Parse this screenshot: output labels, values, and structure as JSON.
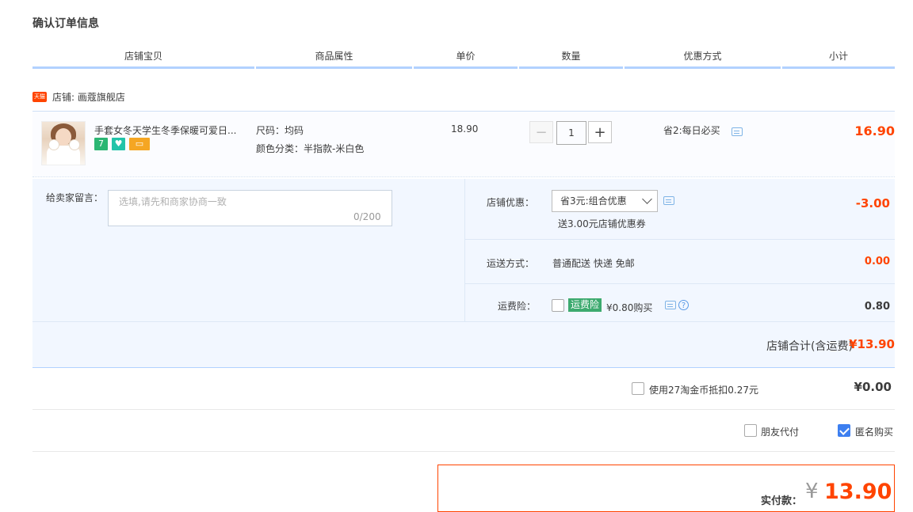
{
  "title": "确认订单信息",
  "columns": [
    "店铺宝贝",
    "商品属性",
    "单价",
    "数量",
    "优惠方式",
    "小计"
  ],
  "shop": {
    "logo_text": "天猫",
    "label": "店铺:",
    "name": "画蔻旗舰店"
  },
  "item": {
    "name": "手套女冬天学生冬季保暖可爱日...",
    "badges": [
      "7",
      "♥",
      "▭"
    ],
    "attr_size": "尺码：均码",
    "attr_color": "颜色分类：半指款-米白色",
    "unit_price": "18.90",
    "quantity": "1",
    "minus": "−",
    "plus": "+",
    "promo": "省2:每日必买",
    "subtotal": "16.90"
  },
  "message": {
    "label": "给卖家留言：",
    "placeholder": "选填,请先和商家协商一致",
    "count": "0/200"
  },
  "shop_discount": {
    "label": "店铺优惠：",
    "selected": "省3元:组合优惠",
    "note": "送3.00元店铺优惠券",
    "amount": "-3.00"
  },
  "shipping": {
    "label": "运送方式：",
    "value": "普通配送 快递 免邮",
    "amount": "0.00"
  },
  "insurance": {
    "label": "运费险：",
    "badge": "运费险",
    "text": "¥0.80购买",
    "help": "?",
    "amount": "0.80"
  },
  "shop_total": {
    "label": "店铺合计(含运费)",
    "amount": "¥13.90"
  },
  "taobao_coins": {
    "label": "使用27淘金币抵扣0.27元",
    "amount": "¥0.00"
  },
  "friend_pay": {
    "label": "朋友代付"
  },
  "anonymous": {
    "label": "匿名购买"
  },
  "pay": {
    "label": "实付款：",
    "currency": "¥",
    "amount": "13.90"
  },
  "colors": {
    "accent_red": "#ff4400",
    "header_rule": "#b2d1ff",
    "panel_bg": "#f2f7ff",
    "check_blue": "#3d7ff0",
    "ins_green": "#3daa6f"
  }
}
